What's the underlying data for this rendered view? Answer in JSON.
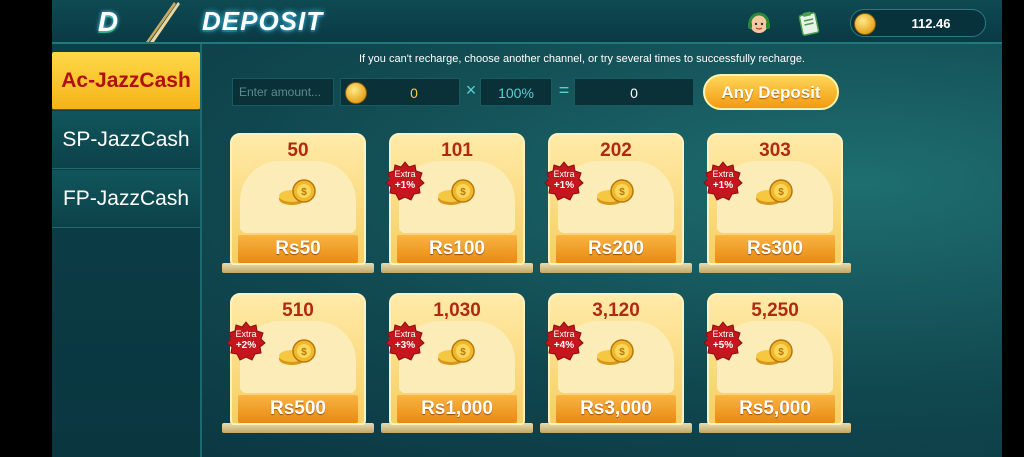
{
  "header": {
    "title": "DEPOSIT",
    "balance": "112.46",
    "colors": {
      "accent": "#f4b418",
      "title_glow": "#4cf"
    }
  },
  "sidebar": {
    "items": [
      {
        "label": "Ac-JazzCash",
        "active": true
      },
      {
        "label": "SP-JazzCash",
        "active": false
      },
      {
        "label": "FP-JazzCash",
        "active": false
      }
    ]
  },
  "notice": "If you can't recharge, choose another channel, or try several times to successfully recharge.",
  "amount_row": {
    "input_placeholder": "Enter amount...",
    "coins_value": "0",
    "multiplier_sign": "×",
    "percent": "100%",
    "equals_sign": "=",
    "total": "0",
    "button_label": "Any Deposit"
  },
  "cards": [
    {
      "coins": "50",
      "price": "Rs50",
      "extra_label": "",
      "extra_pct": ""
    },
    {
      "coins": "101",
      "price": "Rs100",
      "extra_label": "Extra",
      "extra_pct": "+1%"
    },
    {
      "coins": "202",
      "price": "Rs200",
      "extra_label": "Extra",
      "extra_pct": "+1%"
    },
    {
      "coins": "303",
      "price": "Rs300",
      "extra_label": "Extra",
      "extra_pct": "+1%"
    },
    {
      "coins": "510",
      "price": "Rs500",
      "extra_label": "Extra",
      "extra_pct": "+2%"
    },
    {
      "coins": "1,030",
      "price": "Rs1,000",
      "extra_label": "Extra",
      "extra_pct": "+3%"
    },
    {
      "coins": "3,120",
      "price": "Rs3,000",
      "extra_label": "Extra",
      "extra_pct": "+4%"
    },
    {
      "coins": "5,250",
      "price": "Rs5,000",
      "extra_label": "Extra",
      "extra_pct": "+5%"
    }
  ]
}
